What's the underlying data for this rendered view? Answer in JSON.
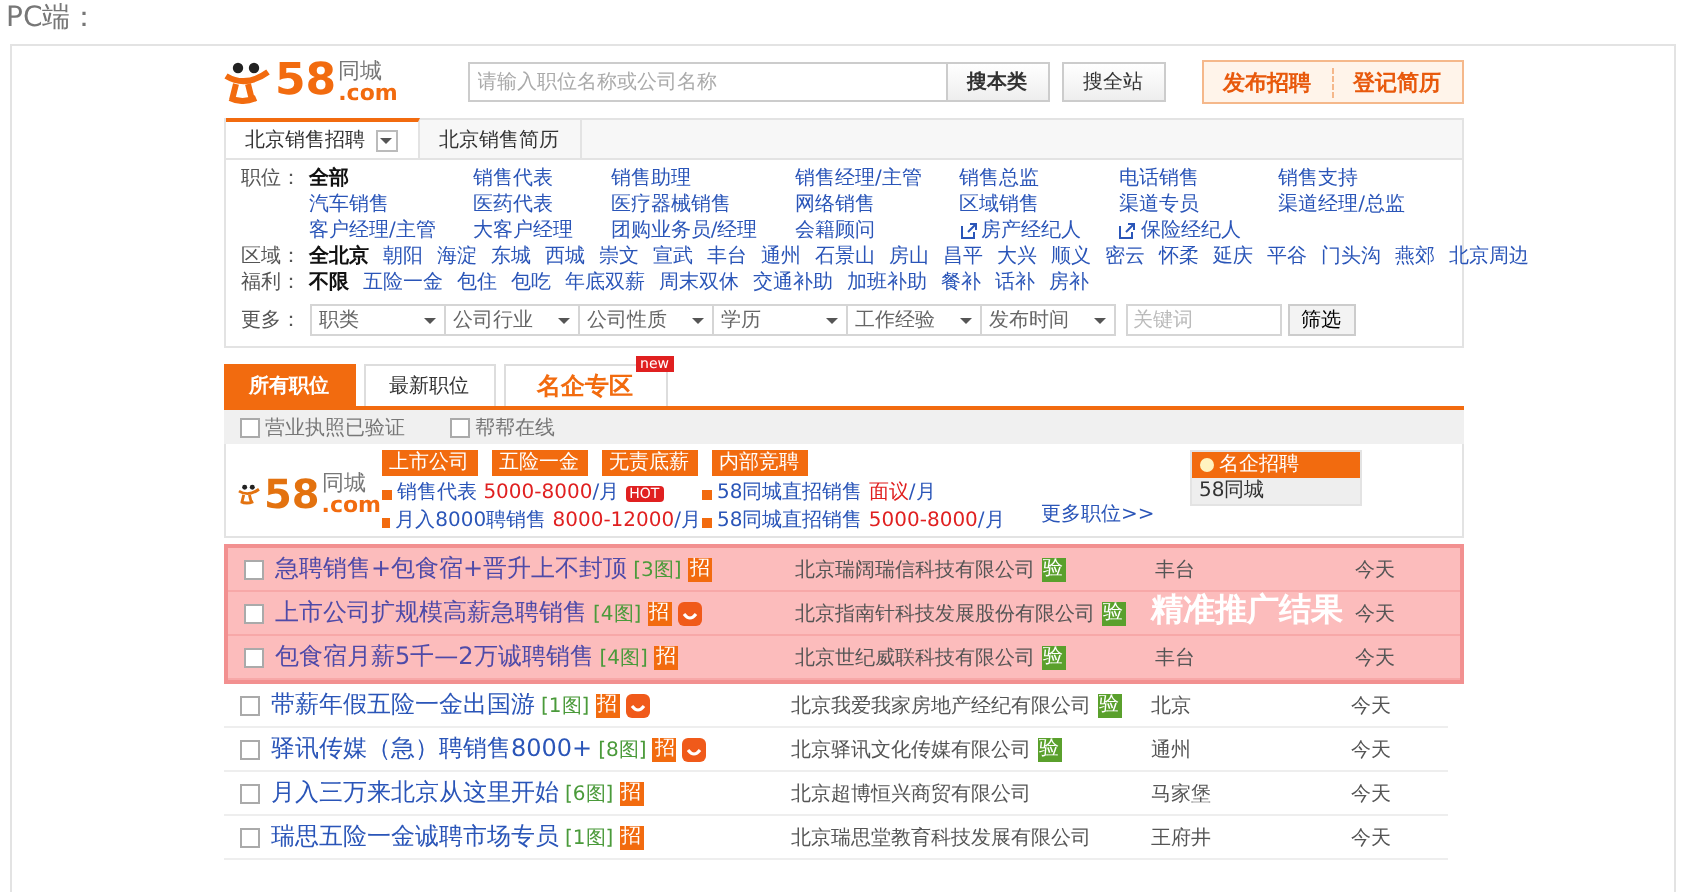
{
  "page_label": "PC端：",
  "header": {
    "logo": {
      "number": "58",
      "name": "同城",
      "domain": ".com"
    },
    "search": {
      "placeholder": "请输入职位名称或公司名称"
    },
    "search_buttons": [
      {
        "label": "搜本类",
        "kind": "primary"
      },
      {
        "label": "搜全站",
        "kind": "secondary"
      }
    ],
    "actions": [
      "发布招聘",
      "登记简历"
    ]
  },
  "city_tabs": [
    {
      "label": "北京销售招聘",
      "selected": true,
      "dropdown": true
    },
    {
      "label": "北京销售简历",
      "selected": false,
      "dropdown": false
    }
  ],
  "filters": {
    "positions": {
      "label": "职位：",
      "items": [
        {
          "text": "全部",
          "selected": true,
          "kind": "plain"
        },
        {
          "text": "销售代表",
          "selected": false,
          "kind": "plain"
        },
        {
          "text": "销售助理",
          "selected": false,
          "kind": "plain"
        },
        {
          "text": "销售经理/主管",
          "selected": false,
          "kind": "plain"
        },
        {
          "text": "销售总监",
          "selected": false,
          "kind": "plain"
        },
        {
          "text": "电话销售",
          "selected": false,
          "kind": "plain"
        },
        {
          "text": "销售支持",
          "selected": false,
          "kind": "plain"
        },
        {
          "text": "汽车销售",
          "selected": false,
          "kind": "plain"
        },
        {
          "text": "医药代表",
          "selected": false,
          "kind": "plain"
        },
        {
          "text": "医疗器械销售",
          "selected": false,
          "kind": "plain"
        },
        {
          "text": "网络销售",
          "selected": false,
          "kind": "plain"
        },
        {
          "text": "区域销售",
          "selected": false,
          "kind": "plain"
        },
        {
          "text": "渠道专员",
          "selected": false,
          "kind": "plain"
        },
        {
          "text": "渠道经理/总监",
          "selected": false,
          "kind": "plain"
        },
        {
          "text": "客户经理/主管",
          "selected": false,
          "kind": "plain"
        },
        {
          "text": "大客户经理",
          "selected": false,
          "kind": "plain"
        },
        {
          "text": "团购业务员/经理",
          "selected": false,
          "kind": "plain"
        },
        {
          "text": "会籍顾问",
          "selected": false,
          "kind": "plain"
        },
        {
          "text": "房产经纪人",
          "selected": false,
          "kind": "external"
        },
        {
          "text": "保险经纪人",
          "selected": false,
          "kind": "external"
        }
      ]
    },
    "regions": {
      "label": "区域：",
      "items": [
        {
          "text": "全北京",
          "selected": true
        },
        {
          "text": "朝阳",
          "selected": false
        },
        {
          "text": "海淀",
          "selected": false
        },
        {
          "text": "东城",
          "selected": false
        },
        {
          "text": "西城",
          "selected": false
        },
        {
          "text": "崇文",
          "selected": false
        },
        {
          "text": "宣武",
          "selected": false
        },
        {
          "text": "丰台",
          "selected": false
        },
        {
          "text": "通州",
          "selected": false
        },
        {
          "text": "石景山",
          "selected": false
        },
        {
          "text": "房山",
          "selected": false
        },
        {
          "text": "昌平",
          "selected": false
        },
        {
          "text": "大兴",
          "selected": false
        },
        {
          "text": "顺义",
          "selected": false
        },
        {
          "text": "密云",
          "selected": false
        },
        {
          "text": "怀柔",
          "selected": false
        },
        {
          "text": "延庆",
          "selected": false
        },
        {
          "text": "平谷",
          "selected": false
        },
        {
          "text": "门头沟",
          "selected": false
        },
        {
          "text": "燕郊",
          "selected": false
        },
        {
          "text": "北京周边",
          "selected": false
        }
      ]
    },
    "welfare": {
      "label": "福利：",
      "items": [
        {
          "text": "不限",
          "selected": true
        },
        {
          "text": "五险一金",
          "selected": false
        },
        {
          "text": "包住",
          "selected": false
        },
        {
          "text": "包吃",
          "selected": false
        },
        {
          "text": "年底双薪",
          "selected": false
        },
        {
          "text": "周末双休",
          "selected": false
        },
        {
          "text": "交通补助",
          "selected": false
        },
        {
          "text": "加班补助",
          "selected": false
        },
        {
          "text": "餐补",
          "selected": false
        },
        {
          "text": "话补",
          "selected": false
        },
        {
          "text": "房补",
          "selected": false
        }
      ]
    },
    "more": {
      "label": "更多：",
      "dropdowns": [
        "职类",
        "公司行业",
        "公司性质",
        "学历",
        "工作经验",
        "发布时间"
      ],
      "keyword_placeholder": "关键词",
      "button": "筛选"
    }
  },
  "result_tabs": [
    {
      "label": "所有职位",
      "selected": true,
      "kind": "normal"
    },
    {
      "label": "最新职位",
      "selected": false,
      "kind": "normal"
    },
    {
      "label": "名企专区",
      "selected": false,
      "kind": "featured",
      "badge": "new"
    }
  ],
  "options": [
    {
      "label": "营业执照已验证",
      "checked": false
    },
    {
      "label": "帮帮在线",
      "checked": false
    }
  ],
  "ad": {
    "logo": {
      "number": "58",
      "name": "同城",
      "domain": ".com"
    },
    "tags": [
      "上市公司",
      "五险一金",
      "无责底薪",
      "内部竞聘"
    ],
    "jobs": [
      {
        "title": "销售代表",
        "salary": "5000-8000",
        "unit": "/月",
        "badge": "HOT"
      },
      {
        "title": "58同城直招销售",
        "salary": "面议",
        "unit": "/月"
      },
      {
        "title": "月入8000聘销售",
        "salary": "8000-12000",
        "unit": "/月"
      },
      {
        "title": "58同城直招销售",
        "salary": "5000-8000",
        "unit": "/月"
      }
    ],
    "more": "更多职位>>",
    "side": {
      "title": "名企招聘",
      "items": [
        "58同城"
      ]
    }
  },
  "listing": {
    "promoted_label": "精准推广结果",
    "rows": [
      {
        "title": "急聘销售+包食宿+晋升上不封顶",
        "photos": "[3图]",
        "badge": "招",
        "online": false,
        "company": "北京瑞阔瑞信科技有限公司",
        "verified": "验",
        "location": "丰台",
        "date": "今天",
        "promoted": true,
        "checked": false
      },
      {
        "title": "上市公司扩规模高薪急聘销售",
        "photos": "[4图]",
        "badge": "招",
        "online": true,
        "company": "北京指南针科技发展股份有限公司",
        "verified": "验",
        "date": "今天",
        "promoted": true,
        "checked": false
      },
      {
        "title": "包食宿月薪5千—2万诚聘销售",
        "photos": "[4图]",
        "badge": "招",
        "online": false,
        "company": "北京世纪威联科技有限公司",
        "verified": "验",
        "location": "丰台",
        "date": "今天",
        "promoted": true,
        "checked": false
      },
      {
        "title": "带薪年假五险一金出国游",
        "photos": "[1图]",
        "badge": "招",
        "online": true,
        "company": "北京我爱我家房地产经纪有限公司",
        "verified": "验",
        "location": "北京",
        "date": "今天",
        "promoted": false,
        "checked": false
      },
      {
        "title": "驿讯传媒（急）聘销售8000+",
        "photos": "[8图]",
        "badge": "招",
        "online": true,
        "company": "北京驿讯文化传媒有限公司",
        "verified": "验",
        "location": "通州",
        "date": "今天",
        "promoted": false,
        "checked": false
      },
      {
        "title": "月入三万来北京从这里开始",
        "photos": "[6图]",
        "badge": "招",
        "online": false,
        "company": "北京超博恒兴商贸有限公司",
        "location": "马家堡",
        "date": "今天",
        "promoted": false,
        "checked": false
      },
      {
        "title": "瑞思五险一金诚聘市场专员",
        "photos": "[1图]",
        "badge": "招",
        "online": false,
        "company": "北京瑞思堂教育科技发展有限公司",
        "location": "王府井",
        "date": "今天",
        "promoted": false,
        "checked": false
      }
    ]
  }
}
